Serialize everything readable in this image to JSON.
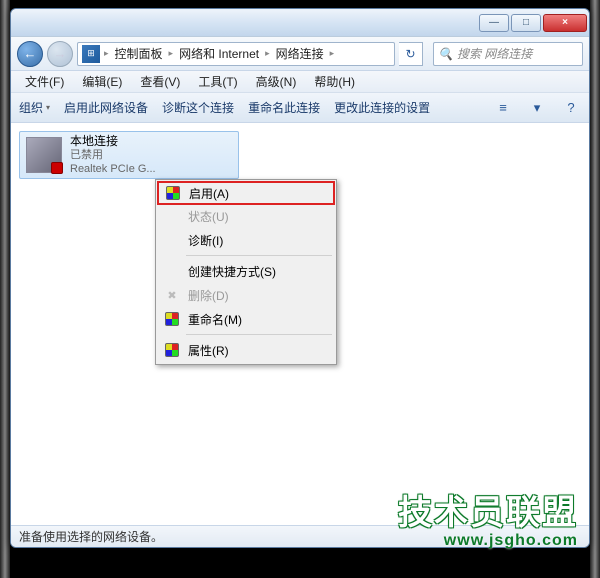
{
  "titlebar": {
    "min": "—",
    "max": "□",
    "close": "×"
  },
  "nav": {
    "back": "←",
    "fwd": "→"
  },
  "breadcrumb": {
    "root": "控制面板",
    "net": "网络和 Internet",
    "conn": "网络连接",
    "sep": "▸"
  },
  "search": {
    "placeholder": "搜索 网络连接",
    "glyph": "🔍"
  },
  "menu": {
    "file": "文件(F)",
    "edit": "编辑(E)",
    "view": "查看(V)",
    "tools": "工具(T)",
    "adv": "高级(N)",
    "help": "帮助(H)"
  },
  "toolbar": {
    "org": "组织",
    "enable": "启用此网络设备",
    "diag": "诊断这个连接",
    "rename": "重命名此连接",
    "settings": "更改此连接的设置",
    "drop": "▾",
    "viewicon": "≡",
    "helpicon": "?"
  },
  "connection": {
    "name": "本地连接",
    "status": "已禁用",
    "device": "Realtek PCIe G..."
  },
  "context": {
    "enable": "启用(A)",
    "status": "状态(U)",
    "diagnose": "诊断(I)",
    "shortcut": "创建快捷方式(S)",
    "delete": "删除(D)",
    "rename": "重命名(M)",
    "properties": "属性(R)"
  },
  "statusbar": {
    "text": "准备使用选择的网络设备。"
  },
  "watermark": {
    "cn": "技术员联盟",
    "url": "www.jsgho.com"
  }
}
